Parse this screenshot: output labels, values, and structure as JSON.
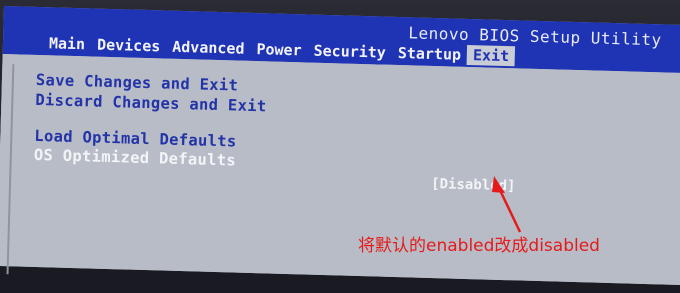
{
  "header": {
    "app_title": "Lenovo BIOS Setup Utility",
    "tabs": [
      {
        "label": "Main"
      },
      {
        "label": "Devices"
      },
      {
        "label": "Advanced"
      },
      {
        "label": "Power"
      },
      {
        "label": "Security"
      },
      {
        "label": "Startup"
      },
      {
        "label": "Exit"
      }
    ],
    "active_tab": "Exit"
  },
  "exit_menu": {
    "items": [
      {
        "label": "Save Changes and Exit"
      },
      {
        "label": "Discard Changes and Exit"
      },
      {
        "label": "Load Optimal Defaults"
      },
      {
        "label": "OS Optimized Defaults",
        "value": "[Disabled]"
      }
    ]
  },
  "annotation": {
    "text": "将默认的enabled改成disabled",
    "color": "#e51b1b"
  },
  "colors": {
    "title_bar": "#1f33b5",
    "panel": "#b8bcc6",
    "option_text": "#2333a8",
    "selected_text": "#f3f4f8"
  }
}
